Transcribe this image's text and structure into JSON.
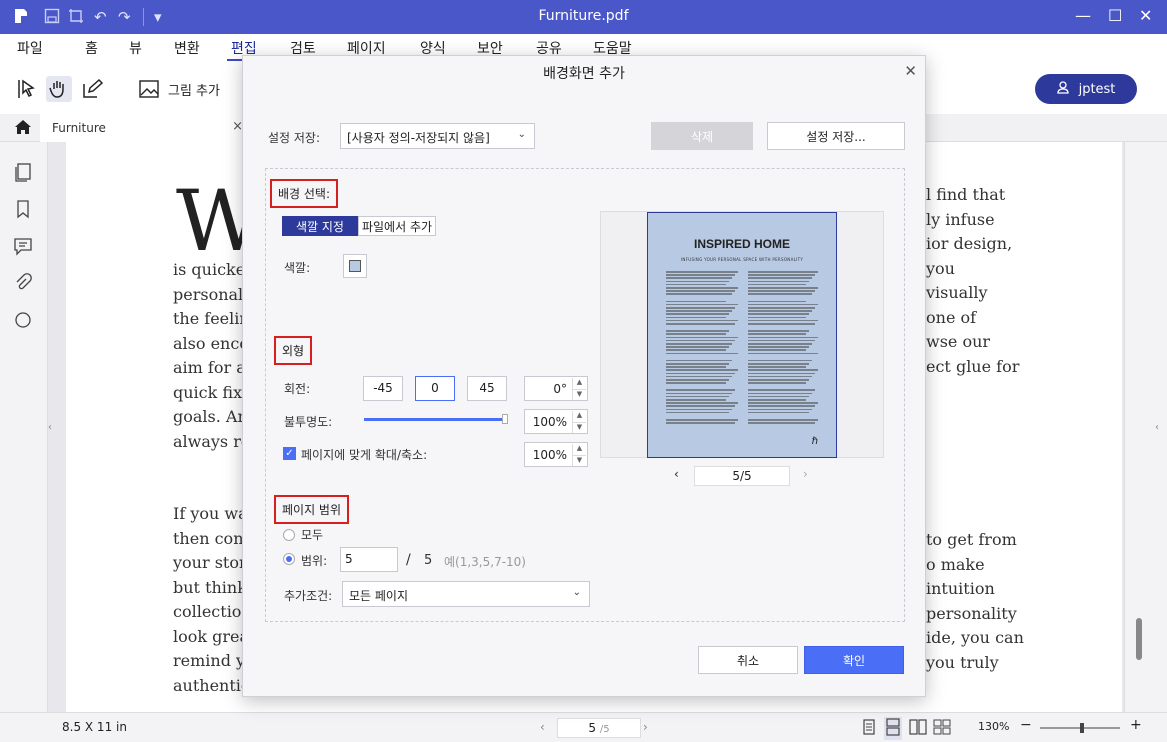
{
  "window": {
    "title": "Furniture.pdf"
  },
  "menu": [
    "파일",
    "홈",
    "뷰",
    "변환",
    "편집",
    "검토",
    "페이지",
    "양식",
    "보안",
    "공유",
    "도움말"
  ],
  "toolbar": {
    "add_image_label": "그림 추가",
    "user_name": "jptest"
  },
  "tab": {
    "label": "Furniture"
  },
  "document": {
    "big_letter": "W",
    "left_lines": [
      "is quicker",
      "personal",
      "the feelin",
      "also enco",
      "aim for a",
      "quick fix",
      "goals. An",
      "always re"
    ],
    "right_lines": [
      "l find that",
      "ly infuse",
      "",
      "",
      "ior design,",
      "you",
      "visually",
      "one of",
      "wse our",
      "ect glue for"
    ],
    "left_lines_2": [
      "If you wa",
      "then cons",
      "your stor",
      "but think",
      "collection",
      "look grea",
      "remind y",
      "authentic"
    ],
    "right_lines_2": [
      "to get from",
      "o make",
      "intuition",
      "personality",
      "ide, you can",
      "you truly",
      ""
    ]
  },
  "status": {
    "page_size": "8.5 X 11 in",
    "page_current": "5",
    "page_total": "/5",
    "zoom": "130%"
  },
  "dialog": {
    "title": "배경화면 추가",
    "settings_label": "설정 저장:",
    "settings_value": "[사용자 정의-저장되지 않음]",
    "delete_button": "삭제",
    "save_settings_button": "설정 저장...",
    "background_section": "배경 선택:",
    "tab_color": "색깔 지정",
    "tab_file": "파일에서 추가",
    "color_label": "색깔:",
    "appearance_section": "외형",
    "rotation_label": "회전:",
    "rotation_options": [
      "-45",
      "0",
      "45"
    ],
    "rotation_value": "0°",
    "opacity_label": "불투명도:",
    "opacity_value": "100%",
    "opacity_fraction": 1.0,
    "scale_label": "페이지에 맞게 확대/축소:",
    "scale_value": "100%",
    "page_range_section": "페이지 범위",
    "all_label": "모두",
    "range_label": "범위:",
    "range_value": "5",
    "range_separator": "/",
    "range_total": "5",
    "range_hint": "예(1,3,5,7-10)",
    "condition_label": "추가조건:",
    "condition_value": "모든 페이지",
    "preview_heading": "INSPIRED HOME",
    "preview_subheading": "INFUSING YOUR PERSONAL SPACE WITH PERSONALITY",
    "preview_page": "5/5",
    "cancel_button": "취소",
    "ok_button": "확인",
    "preview_bg_color": "#b8c9e3"
  }
}
